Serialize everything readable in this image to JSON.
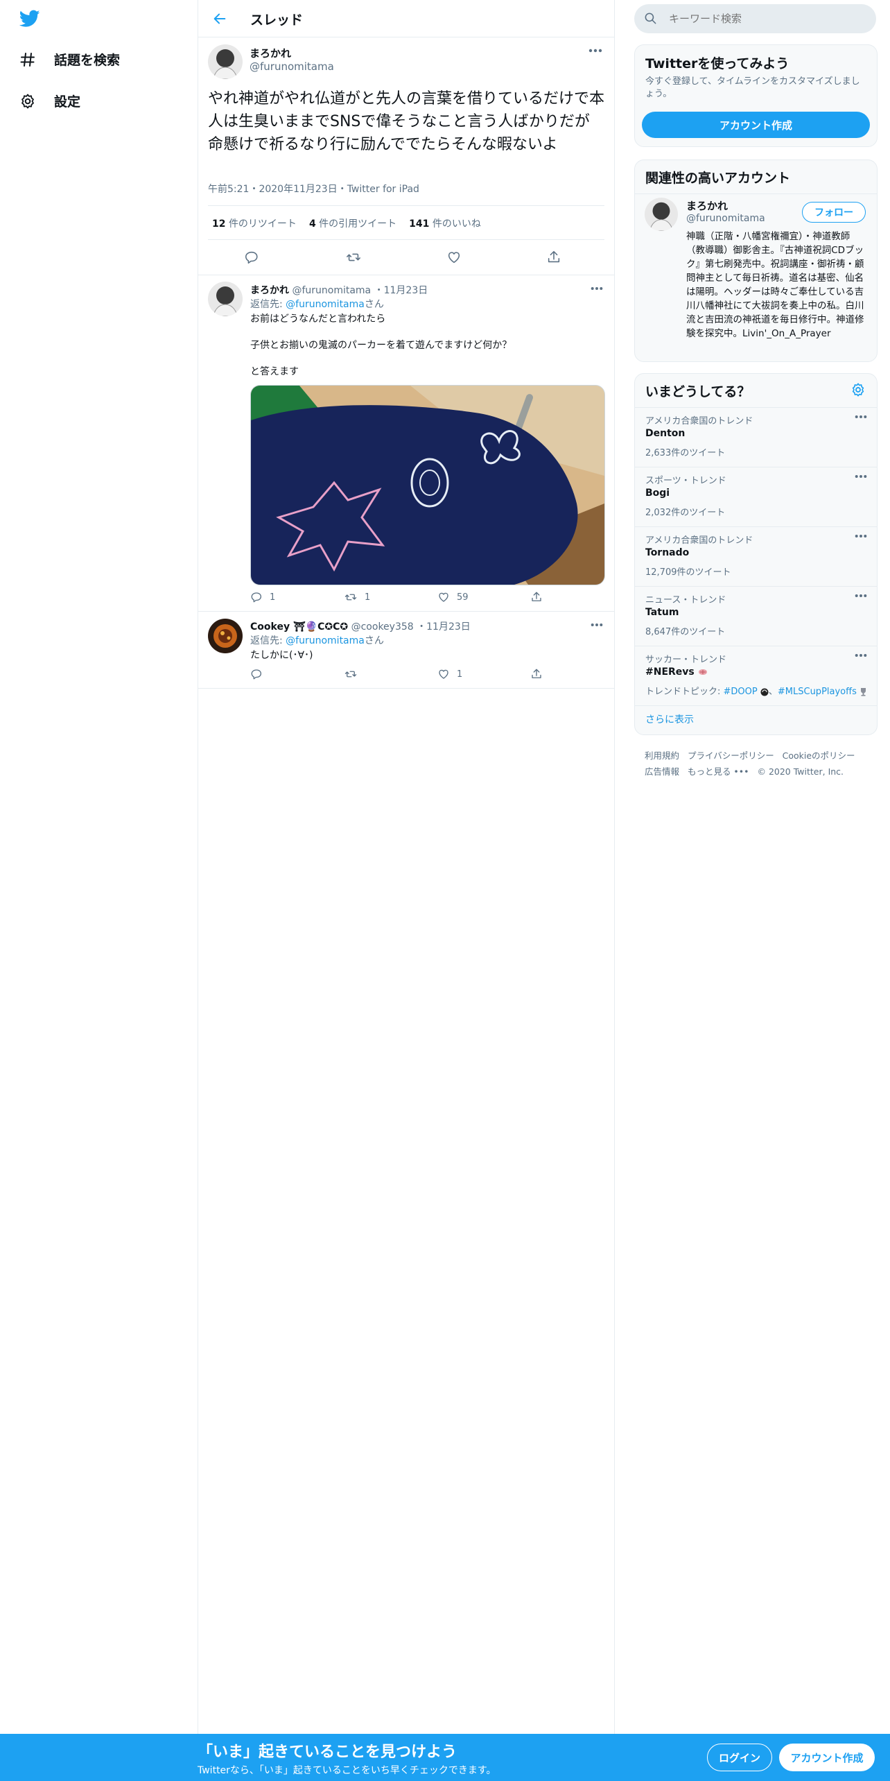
{
  "nav": {
    "explore": "話題を検索",
    "settings": "設定"
  },
  "header": {
    "title": "スレッド"
  },
  "main_tweet": {
    "name": "まろかれ",
    "handle": "@furunomitama",
    "text": "やれ神道がやれ仏道がと先人の言葉を借りているだけで本人は生臭いままでSNSで偉そうなこと言う人ばかりだが\n命懸けで祈るなり行に励んででたらそんな暇ないよ",
    "meta": "午前5:21・2020年11月23日・Twitter for iPad",
    "retweets": "12",
    "retweets_label": "件のリツイート",
    "quotes": "4",
    "quotes_label": "件の引用ツイート",
    "likes": "141",
    "likes_label": "件のいいね"
  },
  "reply1": {
    "name": "まろかれ",
    "handle": "@furunomitama",
    "date": "・11月23日",
    "reply_prefix": "返信先: ",
    "reply_to": "@furunomitama",
    "reply_suffix": "さん",
    "line1": "お前はどうなんだと言われたら",
    "line2": "子供とお揃いの鬼滅のパーカーを着て遊んでますけど何か？",
    "line3": "と答えます",
    "replies": "1",
    "retweets": "1",
    "likes": "59"
  },
  "reply2": {
    "name": "Cookey ⛩🔮C✪C✪",
    "handle": "@cookey358",
    "date": "・11月23日",
    "reply_prefix": "返信先: ",
    "reply_to": "@furunomitama",
    "reply_suffix": "さん",
    "text": "たしかに(･∀･)",
    "likes": "1"
  },
  "search": {
    "placeholder": "キーワード検索"
  },
  "signup_card": {
    "title": "Twitterを使ってみよう",
    "desc": "今すぐ登録して、タイムラインをカスタマイズしましょう。",
    "button": "アカウント作成"
  },
  "related": {
    "title": "関連性の高いアカウント",
    "name": "まろかれ",
    "handle": "@furunomitama",
    "follow": "フォロー",
    "bio": "神職（正階・八幡宮権禰宜）・神道教師（教導職）御影舎主。『古神道祝詞CDブック』第七刷発売中。祝詞講座・御祈祷・顧問神主として毎日祈祷。道名は基密、仙名は陽明。ヘッダーは時々ご奉仕している吉川八幡神社にて大祓詞を奏上中の私。白川流と吉田流の神祇道を毎日修行中。神道修験を探究中。Livin'_On_A_Prayer"
  },
  "trends": {
    "title": "いまどうしてる？",
    "items": [
      {
        "category": "アメリカ合衆国のトレンド",
        "name": "Denton",
        "count": "2,633件のツイート"
      },
      {
        "category": "スポーツ・トレンド",
        "name": "Bogi",
        "count": "2,032件のツイート"
      },
      {
        "category": "アメリカ合衆国のトレンド",
        "name": "Tornado",
        "count": "12,709件のツイート"
      },
      {
        "category": "ニュース・トレンド",
        "name": "Tatum",
        "count": "8,647件のツイート"
      },
      {
        "category": "サッカー・トレンド",
        "name": "#NERevs",
        "count": "トレンドトピック: ",
        "tag1": "#DOOP",
        "sep": "、",
        "tag2": "#MLSCupPlayoffs"
      }
    ],
    "more": "さらに表示"
  },
  "footer": {
    "terms": "利用規約",
    "privacy": "プライバシーポリシー",
    "cookie": "Cookieのポリシー",
    "ads": "広告情報",
    "more": "もっと見る",
    "copyright": "© 2020 Twitter, Inc."
  },
  "bottom_bar": {
    "title": "「いま」起きていることを見つけよう",
    "subtitle": "Twitterなら、「いま」起きていることをいち早くチェックできます。",
    "login": "ログイン",
    "signup": "アカウント作成"
  },
  "colors": {
    "accent": "#1da1f2",
    "link": "#1b95e0",
    "muted": "#5b7083",
    "divider": "#e6ecf0"
  }
}
